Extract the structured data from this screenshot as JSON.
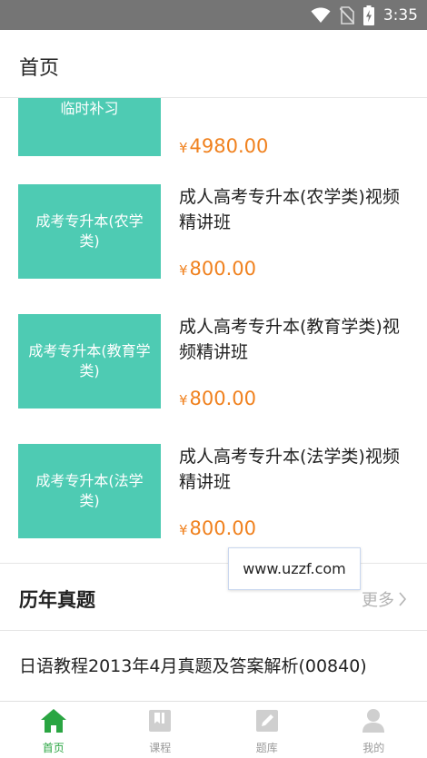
{
  "status_bar": {
    "time": "3:35"
  },
  "app_bar": {
    "title": "首页"
  },
  "courses": [
    {
      "thumb_label": "临时补习",
      "name": "",
      "price": "4980.00",
      "currency": "¥"
    },
    {
      "thumb_label": "成考专升本(农学类)",
      "name": "成人高考专升本(农学类)视频精讲班",
      "price": "800.00",
      "currency": "¥"
    },
    {
      "thumb_label": "成考专升本(教育学类)",
      "name": "成人高考专升本(教育学类)视频精讲班",
      "price": "800.00",
      "currency": "¥"
    },
    {
      "thumb_label": "成考专升本(法学类)",
      "name": "成人高考专升本(法学类)视频精讲班",
      "price": "800.00",
      "currency": "¥"
    }
  ],
  "past_exams": {
    "title": "历年真题",
    "more_label": "更多",
    "items": [
      {
        "title": "日语教程2013年4月真题及答案解析(00840)"
      }
    ]
  },
  "tooltip": {
    "text": "www.uzzf.com"
  },
  "tabs": [
    {
      "label": "首页",
      "icon": "home-icon",
      "active": true
    },
    {
      "label": "课程",
      "icon": "course-icon",
      "active": false
    },
    {
      "label": "题库",
      "icon": "question-bank-icon",
      "active": false
    },
    {
      "label": "我的",
      "icon": "profile-icon",
      "active": false
    }
  ],
  "colors": {
    "accent_green": "#2aa542",
    "thumb_teal": "#4ecbb3",
    "price_orange": "#f0811e",
    "status_bar": "#757575"
  }
}
